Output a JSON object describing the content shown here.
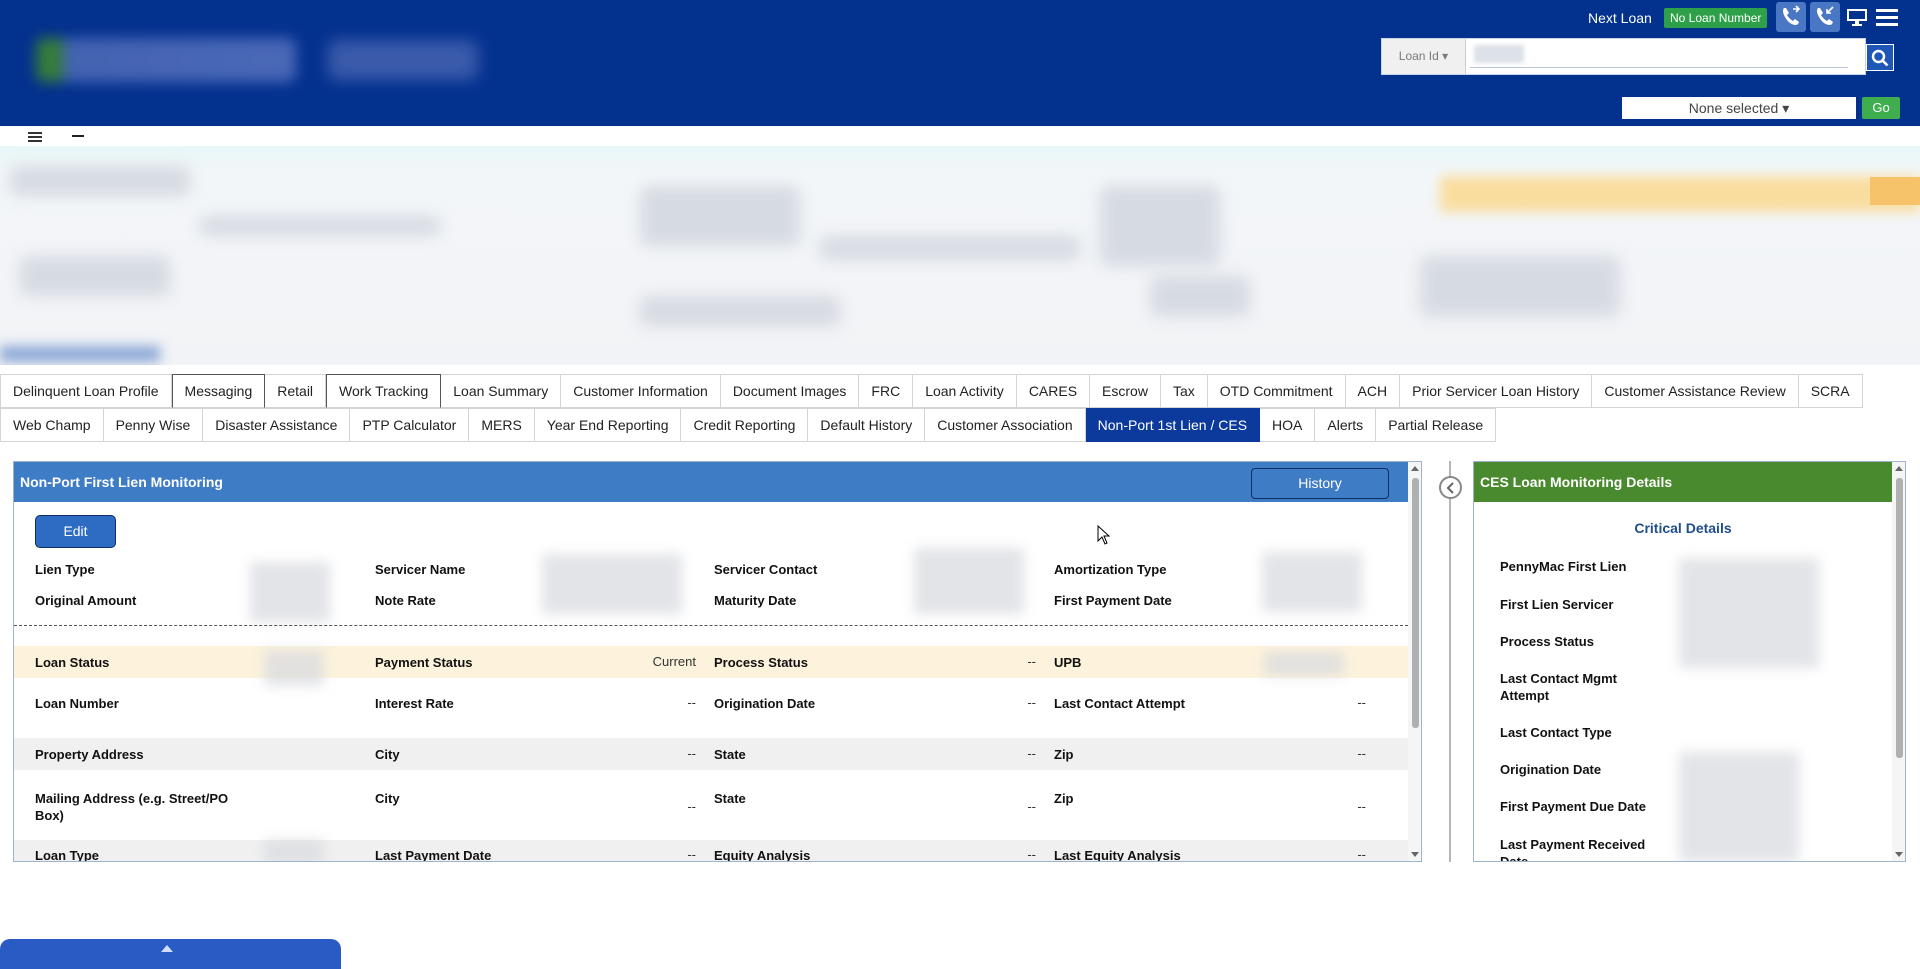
{
  "header": {
    "next_loan": "Next Loan",
    "no_loan_number": "No Loan Number",
    "loan_id_label": "Loan Id",
    "search_placeholder": "",
    "none_selected": "None selected",
    "go_label": "Go",
    "icons": [
      "phone-icon",
      "phone-transfer-icon",
      "monitor-icon",
      "menu-icon"
    ]
  },
  "tabs_row1": [
    "Delinquent Loan Profile",
    "Messaging",
    "Retail",
    "Work Tracking",
    "Loan Summary",
    "Customer Information",
    "Document Images",
    "FRC",
    "Loan Activity",
    "CARES",
    "Escrow",
    "Tax",
    "OTD Commitment",
    "ACH",
    "Prior Servicer Loan History",
    "Customer Assistance Review",
    "SCRA"
  ],
  "tabs_row2": [
    "Web Champ",
    "Penny Wise",
    "Disaster Assistance",
    "PTP Calculator",
    "MERS",
    "Year End Reporting",
    "Credit Reporting",
    "Default History",
    "Customer Association",
    "Non-Port 1st Lien / CES",
    "HOA",
    "Alerts",
    "Partial Release"
  ],
  "active_tab": "Non-Port 1st Lien / CES",
  "left_panel": {
    "title": "Non-Port First Lien Monitoring",
    "history_label": "History",
    "edit_label": "Edit",
    "top_rows": [
      [
        "Lien Type",
        "Servicer Name",
        "Servicer Contact",
        "Amortization Type"
      ],
      [
        "Original Amount",
        "Note Rate",
        "Maturity Date",
        "First Payment Date"
      ]
    ],
    "rows": [
      {
        "c1": "Loan Status",
        "c2": "Payment Status",
        "v2": "Current",
        "c3": "Process Status",
        "v3": "--",
        "c4": "UPB",
        "v4": ""
      },
      {
        "c1": "Loan Number",
        "c2": "Interest Rate",
        "v2": "--",
        "c3": "Origination Date",
        "v3": "--",
        "c4": "Last Contact Attempt",
        "v4": "--"
      },
      {
        "c1": "Property Address",
        "c2": "City",
        "v2": "--",
        "c3": "State",
        "v3": "--",
        "c4": "Zip",
        "v4": "--"
      },
      {
        "c1": "Mailing Address (e.g. Street/PO Box)",
        "c2": "City",
        "v2": "--",
        "c3": "State",
        "v3": "--",
        "c4": "Zip",
        "v4": "--"
      },
      {
        "c1": "Loan Type",
        "c2": "Last Payment Date",
        "v2": "--",
        "c3": "Equity Analysis",
        "v3": "--",
        "c4": "Last Equity Analysis",
        "v4": "--"
      }
    ]
  },
  "right_panel": {
    "title": "CES Loan Monitoring Details",
    "section": "Critical Details",
    "labels": [
      "PennyMac First Lien",
      "First Lien Servicer",
      "Process Status",
      "Last Contact Mgmt Attempt",
      "Last Contact Type",
      "Origination Date",
      "First Payment Due Date",
      "Last Payment Received Date"
    ]
  },
  "colors": {
    "header_bg": "#03318e",
    "panel_left_head": "#3e7cc6",
    "panel_right_head": "#4a8a2e",
    "active_tab": "#0b3a9c",
    "no_loan_badge": "#2fa04a",
    "go_button": "#3fae4e",
    "highlight_row": "#fdf3dc"
  }
}
